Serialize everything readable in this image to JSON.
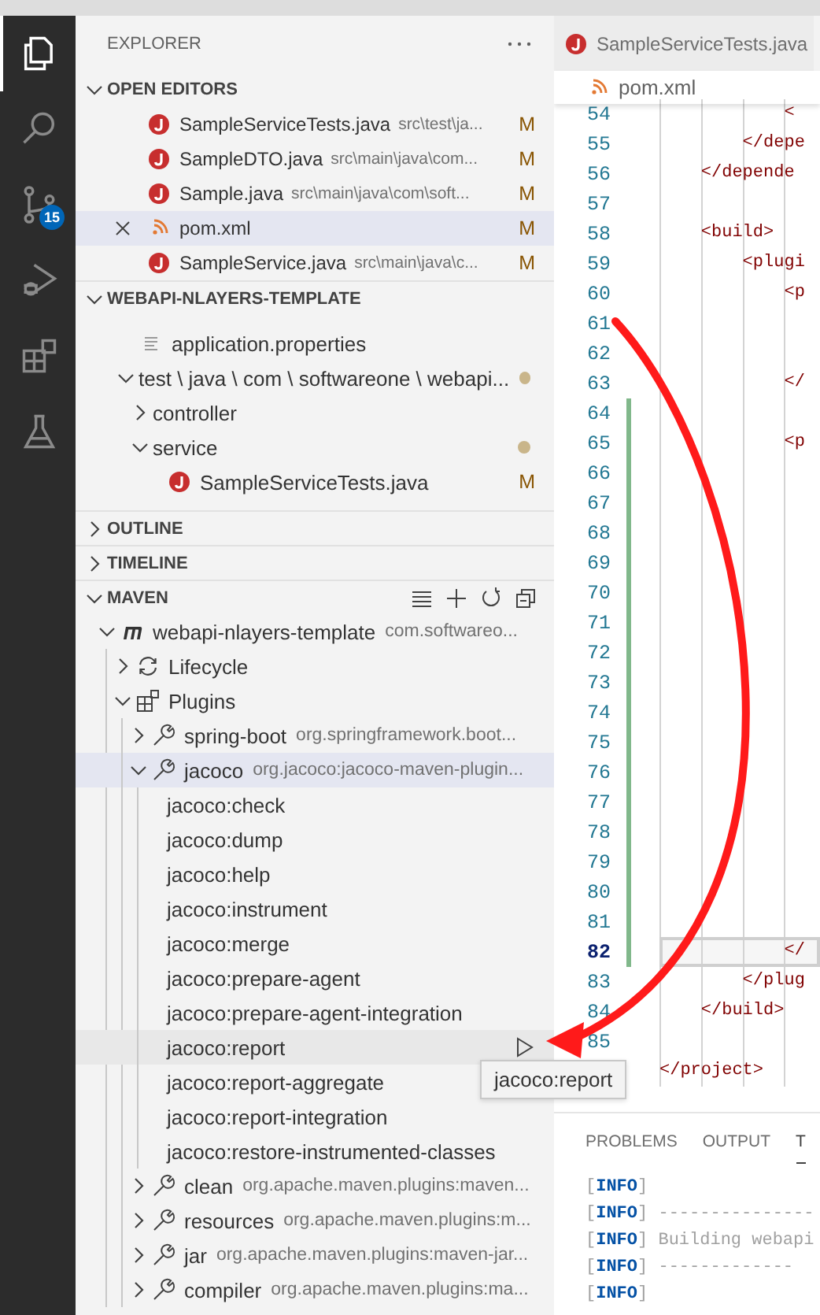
{
  "activity_bar": {
    "items": [
      {
        "kind": "files",
        "selected": true
      },
      {
        "kind": "search",
        "selected": false
      },
      {
        "kind": "source-control",
        "selected": false,
        "badge": "15"
      },
      {
        "kind": "run-debug",
        "selected": false
      },
      {
        "kind": "extensions",
        "selected": false
      },
      {
        "kind": "testing",
        "selected": false
      }
    ]
  },
  "sidebar": {
    "title": "EXPLORER",
    "open_editors": {
      "label": "OPEN EDITORS",
      "expanded": true,
      "items": [
        {
          "name": "SampleServiceTests.java",
          "path": "src\\test\\ja...",
          "status": "M",
          "kind": "java",
          "selected": false
        },
        {
          "name": "SampleDTO.java",
          "path": "src\\main\\java\\com...",
          "status": "M",
          "kind": "java",
          "selected": false
        },
        {
          "name": "Sample.java",
          "path": "src\\main\\java\\com\\soft...",
          "status": "M",
          "kind": "java",
          "selected": false
        },
        {
          "name": "pom.xml",
          "status": "M",
          "kind": "xml",
          "selected": true
        },
        {
          "name": "SampleService.java",
          "path": "src\\main\\java\\c...",
          "status": "M",
          "kind": "java",
          "selected": false
        }
      ]
    },
    "project": {
      "label": "WEBAPI-NLAYERS-TEMPLATE",
      "expanded": true,
      "items": [
        {
          "name": "application.properties",
          "kind": "properties"
        },
        {
          "name": "test \\ java \\ com \\ softwareone \\ webapi...",
          "expanded": true,
          "modified": true,
          "children": [
            {
              "name": "controller",
              "expanded": false,
              "modified": false
            },
            {
              "name": "service",
              "expanded": true,
              "modified": true,
              "children": [
                {
                  "name": "SampleServiceTests.java",
                  "kind": "java",
                  "status": "M"
                }
              ]
            }
          ]
        }
      ]
    },
    "collapsed_sections": [
      {
        "label": "OUTLINE",
        "expanded": false
      },
      {
        "label": "TIMELINE",
        "expanded": false
      }
    ],
    "maven": {
      "label": "MAVEN",
      "expanded": true,
      "items": [
        {
          "name": "webapi-nlayers-template",
          "description": "com.softwareo...",
          "kind": "project",
          "expanded": true,
          "selected": false,
          "children": [
            {
              "name": "Lifecycle",
              "kind": "lifecycle",
              "expanded": false,
              "selected": false
            },
            {
              "name": "Plugins",
              "kind": "plugins",
              "expanded": true,
              "selected": false,
              "children": [
                {
                  "name": "spring-boot",
                  "description": "org.springframework.boot...",
                  "kind": "plugin",
                  "expanded": false,
                  "selected": false
                },
                {
                  "name": "jacoco",
                  "description": "org.jacoco:jacoco-maven-plugin...",
                  "kind": "plugin",
                  "expanded": true,
                  "selected": true,
                  "children": [
                    {
                      "name": "jacoco:check",
                      "selected": false,
                      "hovered": false
                    },
                    {
                      "name": "jacoco:dump",
                      "selected": false,
                      "hovered": false
                    },
                    {
                      "name": "jacoco:help",
                      "selected": false,
                      "hovered": false
                    },
                    {
                      "name": "jacoco:instrument",
                      "selected": false,
                      "hovered": false
                    },
                    {
                      "name": "jacoco:merge",
                      "selected": false,
                      "hovered": false
                    },
                    {
                      "name": "jacoco:prepare-agent",
                      "selected": false,
                      "hovered": false
                    },
                    {
                      "name": "jacoco:prepare-agent-integration",
                      "selected": false,
                      "hovered": false
                    },
                    {
                      "name": "jacoco:report",
                      "selected": false,
                      "hovered": true
                    },
                    {
                      "name": "jacoco:report-aggregate",
                      "selected": false,
                      "hovered": false
                    },
                    {
                      "name": "jacoco:report-integration",
                      "selected": false,
                      "hovered": false
                    },
                    {
                      "name": "jacoco:restore-instrumented-classes",
                      "selected": false,
                      "hovered": false
                    }
                  ]
                },
                {
                  "name": "clean",
                  "description": "org.apache.maven.plugins:maven...",
                  "kind": "plugin",
                  "expanded": false,
                  "selected": false
                },
                {
                  "name": "resources",
                  "description": "org.apache.maven.plugins:m...",
                  "kind": "plugin",
                  "expanded": false,
                  "selected": false
                },
                {
                  "name": "jar",
                  "description": "org.apache.maven.plugins:maven-jar...",
                  "kind": "plugin",
                  "expanded": false,
                  "selected": false
                },
                {
                  "name": "compiler",
                  "description": "org.apache.maven.plugins:ma...",
                  "kind": "plugin",
                  "expanded": false,
                  "selected": false
                }
              ]
            }
          ]
        }
      ]
    }
  },
  "editor": {
    "tabs": [
      {
        "name": "SampleServiceTests.java",
        "kind": "java",
        "selected": false
      }
    ],
    "breadcrumb": {
      "name": "pom.xml",
      "kind": "xml"
    },
    "lines": [
      {
        "number": "54",
        "text": "            <",
        "modified": false,
        "current": false
      },
      {
        "number": "55",
        "text": "        </depe",
        "modified": false,
        "current": false
      },
      {
        "number": "56",
        "text": "    </depende",
        "modified": false,
        "current": false
      },
      {
        "number": "57",
        "modified": false,
        "current": false
      },
      {
        "number": "58",
        "text": "    <build>",
        "modified": false,
        "current": false
      },
      {
        "number": "59",
        "text": "        <plugi",
        "modified": false,
        "current": false
      },
      {
        "number": "60",
        "text": "            <p",
        "modified": false,
        "current": false
      },
      {
        "number": "61",
        "modified": false,
        "current": false
      },
      {
        "number": "62",
        "modified": false,
        "current": false
      },
      {
        "number": "63",
        "text": "            </",
        "modified": false,
        "current": false
      },
      {
        "number": "64",
        "modified": true,
        "current": false
      },
      {
        "number": "65",
        "text": "            <p",
        "modified": true,
        "current": false
      },
      {
        "number": "66",
        "modified": true,
        "current": false
      },
      {
        "number": "67",
        "modified": true,
        "current": false
      },
      {
        "number": "68",
        "modified": true,
        "current": false
      },
      {
        "number": "69",
        "modified": true,
        "current": false
      },
      {
        "number": "70",
        "modified": true,
        "current": false
      },
      {
        "number": "71",
        "modified": true,
        "current": false
      },
      {
        "number": "72",
        "modified": true,
        "current": false
      },
      {
        "number": "73",
        "modified": true,
        "current": false
      },
      {
        "number": "74",
        "modified": true,
        "current": false
      },
      {
        "number": "75",
        "modified": true,
        "current": false
      },
      {
        "number": "76",
        "modified": true,
        "current": false
      },
      {
        "number": "77",
        "modified": true,
        "current": false
      },
      {
        "number": "78",
        "modified": true,
        "current": false
      },
      {
        "number": "79",
        "modified": true,
        "current": false
      },
      {
        "number": "80",
        "modified": true,
        "current": false
      },
      {
        "number": "81",
        "modified": true,
        "current": false
      },
      {
        "number": "82",
        "text": "            </",
        "modified": true,
        "current": true
      },
      {
        "number": "83",
        "text": "        </plug",
        "modified": false,
        "current": false
      },
      {
        "number": "84",
        "text": "    </build>",
        "modified": false,
        "current": false
      },
      {
        "number": "85",
        "modified": false,
        "current": false
      },
      {
        "text": "</project>",
        "modified": false,
        "current": false
      }
    ]
  },
  "tooltip": {
    "text": "jacoco:report"
  },
  "panel": {
    "tabs": [
      {
        "label": "PROBLEMS",
        "selected": false
      },
      {
        "label": "OUTPUT",
        "selected": false
      },
      {
        "label": "T",
        "selected": true
      }
    ],
    "terminal_lines": [
      "[**INFO**]",
      "[**INFO**] ---------------",
      "[**INFO**] Building webapi",
      "[**INFO**] -------------",
      "[**INFO**]"
    ]
  }
}
